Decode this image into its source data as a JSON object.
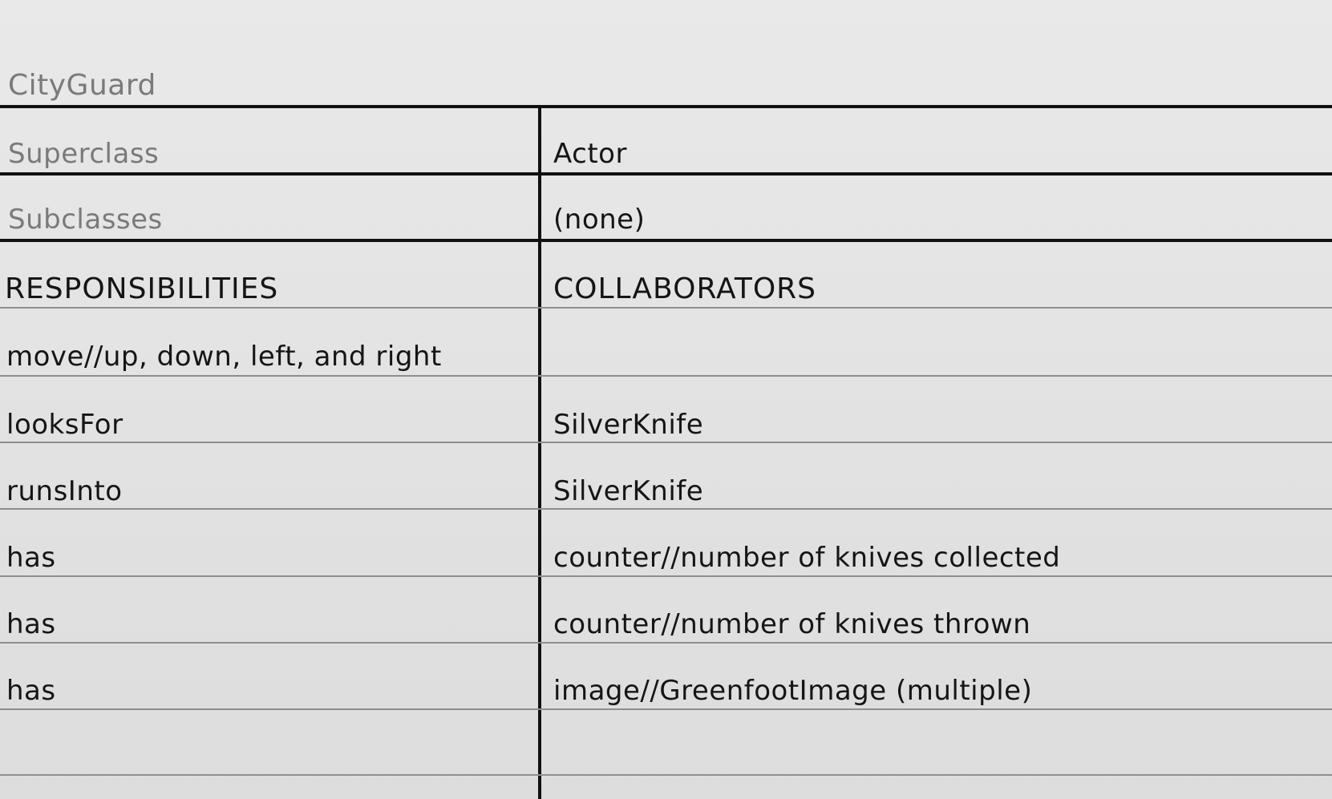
{
  "card": {
    "class_name": "CityGuard",
    "superclass_label": "Superclass",
    "superclass_value": "Actor",
    "subclasses_label": "Subclasses",
    "subclasses_value": "(none)",
    "responsibilities_header": "RESPONSIBILITIES",
    "collaborators_header": "COLLABORATORS",
    "rows": [
      {
        "responsibility": "move//up, down, left, and right",
        "collaborator": ""
      },
      {
        "responsibility": "looksFor",
        "collaborator": "SilverKnife"
      },
      {
        "responsibility": "runsInto",
        "collaborator": "SilverKnife"
      },
      {
        "responsibility": "has",
        "collaborator": "counter//number of knives collected"
      },
      {
        "responsibility": "has",
        "collaborator": "counter//number of knives thrown"
      },
      {
        "responsibility": "has",
        "collaborator": "image//GreenfootImage (multiple)"
      }
    ]
  }
}
